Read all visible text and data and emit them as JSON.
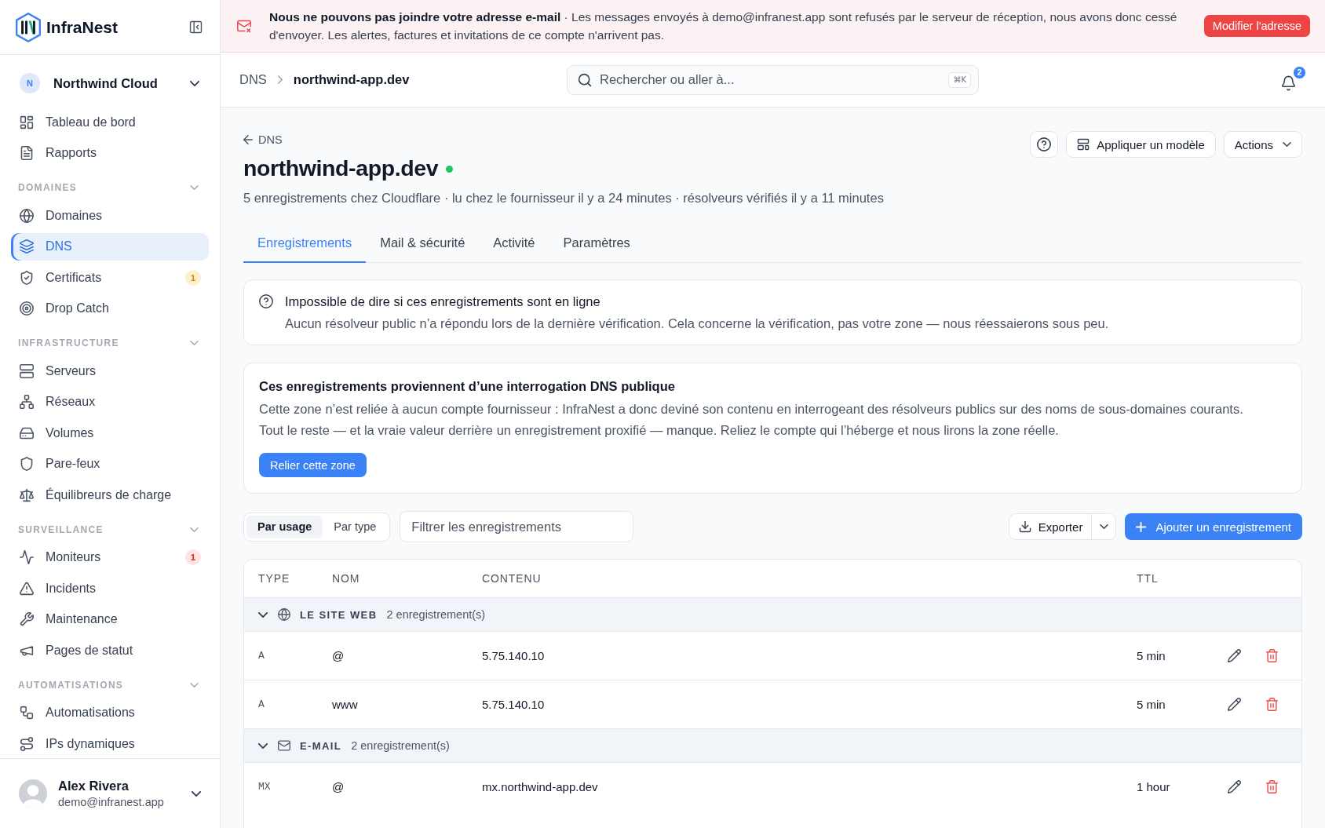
{
  "sidebar": {
    "brand": "InfraNest",
    "workspace": {
      "initial": "N",
      "name": "Northwind Cloud"
    },
    "items": [
      {
        "label": "Tableau de bord",
        "selected": false
      },
      {
        "label": "Rapports",
        "selected": false
      }
    ],
    "sections": [
      {
        "heading": "DOMAINES",
        "expanded": true,
        "items": [
          {
            "label": "Domaines",
            "selected": false
          },
          {
            "label": "DNS",
            "selected": true
          },
          {
            "label": "Certificats",
            "selected": false,
            "badge": {
              "text": "1",
              "kind": "warning"
            }
          },
          {
            "label": "Drop Catch",
            "selected": false
          }
        ]
      },
      {
        "heading": "INFRASTRUCTURE",
        "expanded": true,
        "items": [
          {
            "label": "Serveurs",
            "selected": false
          },
          {
            "label": "Réseaux",
            "selected": false
          },
          {
            "label": "Volumes",
            "selected": false
          },
          {
            "label": "Pare-feux",
            "selected": false
          },
          {
            "label": "Équilibreurs de charge",
            "selected": false
          }
        ]
      },
      {
        "heading": "SURVEILLANCE",
        "expanded": true,
        "items": [
          {
            "label": "Moniteurs",
            "selected": false,
            "badge": {
              "text": "1",
              "kind": "danger"
            }
          },
          {
            "label": "Incidents",
            "selected": false
          },
          {
            "label": "Maintenance",
            "selected": false
          },
          {
            "label": "Pages de statut",
            "selected": false
          }
        ]
      },
      {
        "heading": "AUTOMATISATIONS",
        "expanded": true,
        "items": [
          {
            "label": "Automatisations",
            "selected": false
          },
          {
            "label": "IPs dynamiques",
            "selected": false
          }
        ]
      }
    ],
    "user": {
      "name": "Alex Rivera",
      "email": "demo@infranest.app"
    }
  },
  "banner": {
    "message": "**Nous ne pouvons pas joindre votre adresse e-mail** · Les messages envoyés à demo@infranest.app sont refusés par le serveur de réception, nous avons donc cessé d'envoyer. Les alertes, factures et invitations de ce compte n'arrivent pas.",
    "button": "Modifier l'adresse"
  },
  "header": {
    "breadcrumbs": [
      {
        "label": "DNS"
      },
      {
        "label": "northwind-app.dev"
      }
    ],
    "search": {
      "placeholder": "Rechercher ou aller à...",
      "shortcut": "⌘K"
    },
    "notifications": "2"
  },
  "page": {
    "back": "DNS",
    "title": "northwind-app.dev",
    "online": true,
    "subtitle": "5 enregistrements chez Cloudflare · lu chez le fournisseur il y a 24 minutes · résolveurs vérifiés il y a 11 minutes",
    "actions": [
      {
        "kind": "help"
      },
      {
        "kind": "template",
        "label": "Appliquer un modèle"
      },
      {
        "kind": "menu",
        "label": "Actions"
      }
    ]
  },
  "tabs": [
    {
      "label": "Enregistrements",
      "selected": true
    },
    {
      "label": "Mail & sécurité",
      "selected": false
    },
    {
      "label": "Activité",
      "selected": false
    },
    {
      "label": "Paramètres",
      "selected": false
    }
  ],
  "notices": [
    {
      "kind": "info",
      "title": "Impossible de dire si ces enregistrements sont en ligne",
      "text": "Aucun résolveur public n’a répondu lors de la dernière vérification. Cela concerne la vérification, pas votre zone — nous réessaierons sous peu."
    },
    {
      "kind": "callout",
      "title": "Ces enregistrements proviennent d’une interrogation DNS publique",
      "text": "Cette zone n’est reliée à aucun compte fournisseur : InfraNest a donc deviné son contenu en interrogeant des résolveurs publics sur des noms de sous-domaines courants. Tout le reste — et la vraie valeur derrière un enregistrement proxifié — manque. Reliez le compte qui l’héberge et nous lirons la zone réelle.",
      "button": "Relier cette zone"
    }
  ],
  "toolbar": {
    "views": [
      {
        "label": "Par usage",
        "selected": true
      },
      {
        "label": "Par type",
        "selected": false
      }
    ],
    "filter": {
      "placeholder": "Filtrer les enregistrements"
    },
    "export": "Exporter",
    "add": "Ajouter un enregistrement"
  },
  "table": {
    "columns": [
      "TYPE",
      "NOM",
      "CONTENU",
      "TTL"
    ],
    "groups": [
      {
        "kind": "web",
        "label": "LE SITE WEB",
        "count": "2 enregistrement(s)",
        "expanded": true,
        "rows": [
          {
            "type": "A",
            "name": "@",
            "content": "5.75.140.10",
            "ttl": "5 min"
          },
          {
            "type": "A",
            "name": "www",
            "content": "5.75.140.10",
            "ttl": "5 min"
          }
        ]
      },
      {
        "kind": "mail",
        "label": "E-MAIL",
        "count": "2 enregistrement(s)",
        "expanded": true,
        "rows": [
          {
            "type": "MX",
            "name": "@",
            "content": "mx.northwind-app.dev",
            "ttl": "1 hour"
          }
        ]
      }
    ]
  }
}
